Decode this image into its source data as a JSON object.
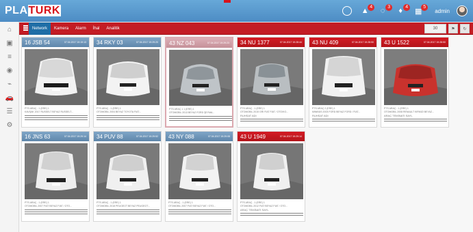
{
  "app": {
    "logo_prefix": "PLA",
    "logo_suffix": "TURK"
  },
  "topbar": {
    "items": [
      {
        "icon": "search-icon",
        "badge": ""
      },
      {
        "icon": "bell-icon",
        "badge": "4"
      },
      {
        "icon": "alarm-icon",
        "badge": "3"
      },
      {
        "icon": "location-icon",
        "badge": "4"
      },
      {
        "icon": "grid-icon",
        "badge": "5"
      }
    ],
    "user": "admin"
  },
  "sidebar": {
    "icons": [
      "home-icon",
      "image-icon",
      "list-icon",
      "eye-icon",
      "chart-icon",
      "car-icon",
      "database-icon",
      "settings-icon"
    ]
  },
  "tabs": [
    "Network",
    "Kamera",
    "Alarm",
    "İhal",
    "Analitik"
  ],
  "controls": {
    "select_value": "30"
  },
  "cards": [
    {
      "plate": "16 JSB 54",
      "time": "07.04.2017 19:19:13",
      "header_color": "blue",
      "meta1": "PTS ARAÇ - 1 (ERE) 1",
      "meta2": "KAVŞAK 2017 RUSSELT BEYAZ RUSSELT..."
    },
    {
      "plate": "34 RKY 03",
      "time": "07.04.2017 19:29:20",
      "header_color": "blue",
      "meta1": "PTS ARAÇ - 1 (ERE) 1",
      "meta2": "OTOMOBİL 2004 BEYAZ TOYOTA FIAT..."
    },
    {
      "plate": "43 NZ 043",
      "time": "07.04.2017 19:29:23",
      "header_color": "pink",
      "selected": true,
      "meta1": "PTS ARAÇ 1 1 (ERE) 1",
      "meta2": "OTOMOBİL 2013 BEYAZ FORD ŞEYMA..."
    },
    {
      "plate": "34 NU 1377",
      "time": "07.04.2017 19:28:44",
      "header_color": "red",
      "meta1": "PTS ARAÇ - 1 (ERE) 1",
      "meta2": "OTOMOBİL 2015 GRİ FIAT FIAT / OTO/KO...",
      "meta3": "RUHSAT ADI"
    },
    {
      "plate": "43 NU 409",
      "time": "07.04.2017 19:28:50",
      "header_color": "red",
      "meta1": "PTS ARAÇ 2 (ERE) 1",
      "meta2": "MİNİBÜS 2003 FORD BEYAZ FORD / FIAT...",
      "meta3": "RUHSAT ADI"
    },
    {
      "plate": "43 U 1522",
      "time": "07.04.2017 19:28:50",
      "header_color": "red",
      "meta1": "PTS ARAÇ - 1 (ERE) 1",
      "meta2": "OTOMOBİL 2008 RENAULT KIRMIZI BEYAZ...",
      "meta3": "ARAÇ TEMİNATI SAYL"
    },
    {
      "plate": "16 JNS 63",
      "time": "07.04.2017 19:29:14",
      "header_color": "blue",
      "meta1": "PTS ARAÇ - 1 (ERE) 1",
      "meta2": "OTOMOBİL 2007 FIAT BEYAZ FIAT / OTO..."
    },
    {
      "plate": "34 PUV 88",
      "time": "07.04.2017 19:29:52",
      "header_color": "blue",
      "meta1": "PTS ARAÇ - 1 (ERE) 1",
      "meta2": "OTOMOBİL 2018 PEUGEOT BEYAZ PEUGEOT..."
    },
    {
      "plate": "43 NY 088",
      "time": "07.04.2017 19:29:08",
      "header_color": "blue",
      "meta1": "PTS ARAÇ - 1 (ERE) 1",
      "meta2": "OTOMOBİL 2007 FIAT BEYAZ FIAT / OTO..."
    },
    {
      "plate": "43 U 1949",
      "time": "07.04.2017 19:29:14",
      "header_color": "red",
      "meta1": "PTS ARAÇ - 1 (ERE) 1",
      "meta2": "OTOMOBİL 2012 FIAT BEYAZ FIAT / OTO...",
      "meta3": "ARAÇ TEMİNATI SAYL"
    }
  ]
}
